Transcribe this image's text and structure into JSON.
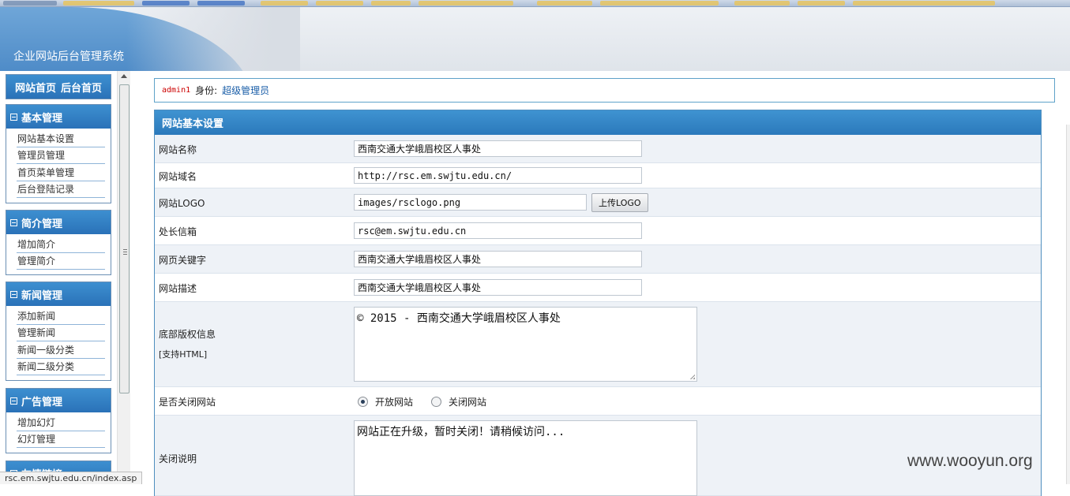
{
  "header": {
    "title": "企业网站后台管理系统"
  },
  "sidebar": {
    "home": {
      "site_home": "网站首页",
      "admin_home": "后台首页"
    },
    "menus": [
      {
        "title": "基本管理",
        "items": [
          "网站基本设置",
          "管理员管理",
          "首页菜单管理",
          "后台登陆记录"
        ]
      },
      {
        "title": "简介管理",
        "items": [
          "增加简介",
          "管理简介"
        ]
      },
      {
        "title": "新闻管理",
        "items": [
          "添加新闻",
          "管理新闻",
          "新闻一级分类",
          "新闻二级分类"
        ]
      },
      {
        "title": "广告管理",
        "items": [
          "增加幻灯",
          "幻灯管理"
        ]
      },
      {
        "title": "友情链接",
        "items": []
      }
    ]
  },
  "userbar": {
    "username": "admin1",
    "role_label": "身份:",
    "role": "超级管理员"
  },
  "panel": {
    "title": "网站基本设置",
    "fields": {
      "site_name": {
        "label": "网站名称",
        "value": "西南交通大学峨眉校区人事处"
      },
      "site_domain": {
        "label": "网站域名",
        "value": "http://rsc.em.swjtu.edu.cn/"
      },
      "site_logo": {
        "label": "网站LOGO",
        "value": "images/rsclogo.png",
        "button": "上传LOGO"
      },
      "email": {
        "label": "处长信箱",
        "value": " rsc@em.swjtu.edu.cn"
      },
      "keywords": {
        "label": "网页关键字",
        "value": "西南交通大学峨眉校区人事处"
      },
      "description": {
        "label": "网站描述",
        "value": "西南交通大学峨眉校区人事处"
      },
      "copyright": {
        "label": "底部版权信息",
        "label2": "[支持HTML]",
        "value": "© 2015 - 西南交通大学峨眉校区人事处"
      },
      "close_site": {
        "label": "是否关闭网站",
        "open": "开放网站",
        "close": "关闭网站",
        "selected": "open"
      },
      "close_note": {
        "label": "关闭说明",
        "value": "网站正在升级，暂时关闭！请稍候访问..."
      }
    }
  },
  "statusbar": {
    "url": "rsc.em.swjtu.edu.cn/index.asp"
  },
  "watermark": "www.wooyun.org"
}
